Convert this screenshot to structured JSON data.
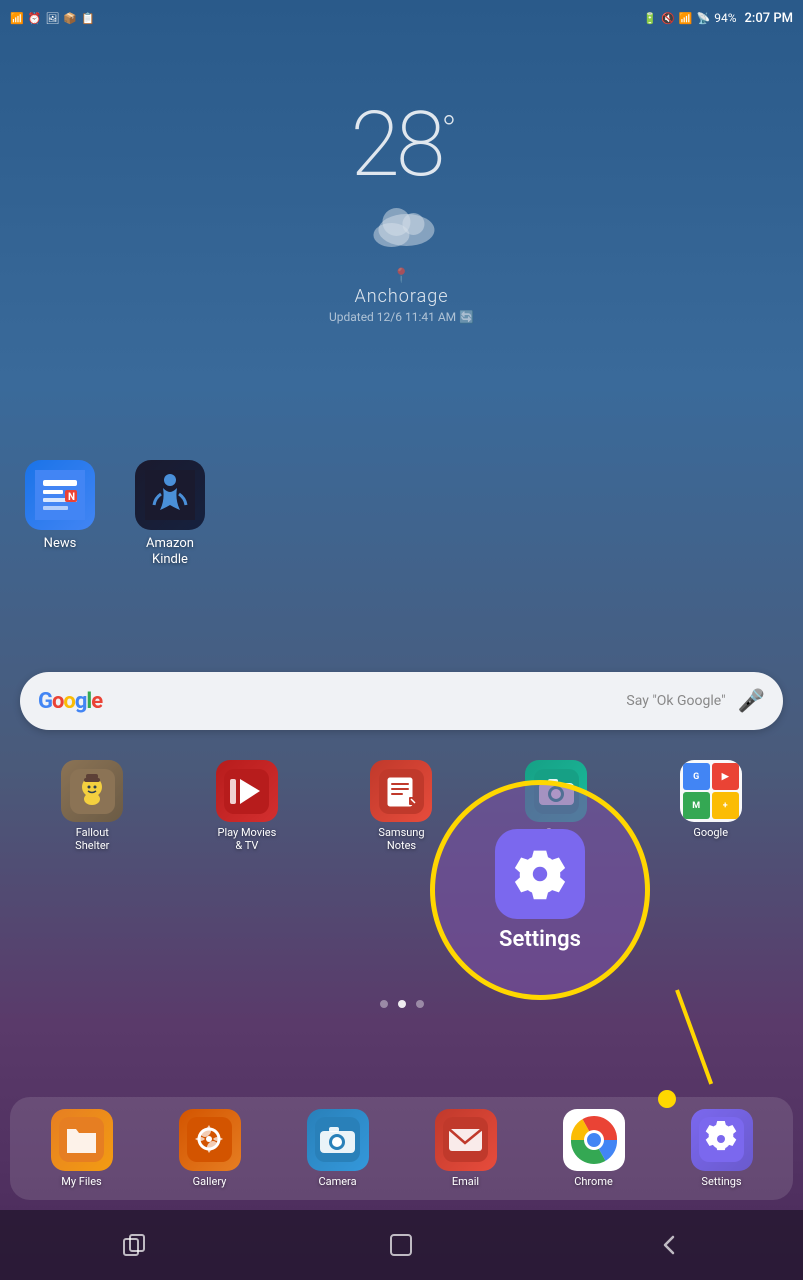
{
  "statusBar": {
    "time": "2:07 PM",
    "battery": "94%",
    "batteryIcon": "🔋"
  },
  "weather": {
    "temperature": "28",
    "degree": "°",
    "city": "Anchorage",
    "updated": "Updated 12/6 11:41 AM",
    "cloudIcon": "☁"
  },
  "googleBar": {
    "sayText": "Say \"Ok Google\"",
    "logoLetters": [
      "G",
      "o",
      "o",
      "g",
      "l",
      "e"
    ]
  },
  "apps": {
    "topRow": [
      {
        "id": "news",
        "label": "News"
      },
      {
        "id": "kindle",
        "label": "Amazon\nKindle"
      }
    ],
    "mainGrid": [
      {
        "id": "fallout",
        "label": "Fallout\nShelter"
      },
      {
        "id": "playmovies",
        "label": "Play Movies\n& TV"
      },
      {
        "id": "samsungnotes",
        "label": "Samsung\nNotes"
      },
      {
        "id": "camera",
        "label": "Ca..."
      },
      {
        "id": "google",
        "label": "Google"
      }
    ]
  },
  "settingsHighlight": {
    "label": "Settings"
  },
  "dock": [
    {
      "id": "myfiles",
      "label": "My Files"
    },
    {
      "id": "gallery",
      "label": "Gallery"
    },
    {
      "id": "camapp",
      "label": "Camera"
    },
    {
      "id": "email",
      "label": "Email"
    },
    {
      "id": "chrome",
      "label": "Chrome"
    },
    {
      "id": "settings",
      "label": "Settings"
    }
  ],
  "pageDots": [
    false,
    true,
    false
  ],
  "navBar": {
    "back": "←",
    "home": "□",
    "recents": "⇌"
  }
}
